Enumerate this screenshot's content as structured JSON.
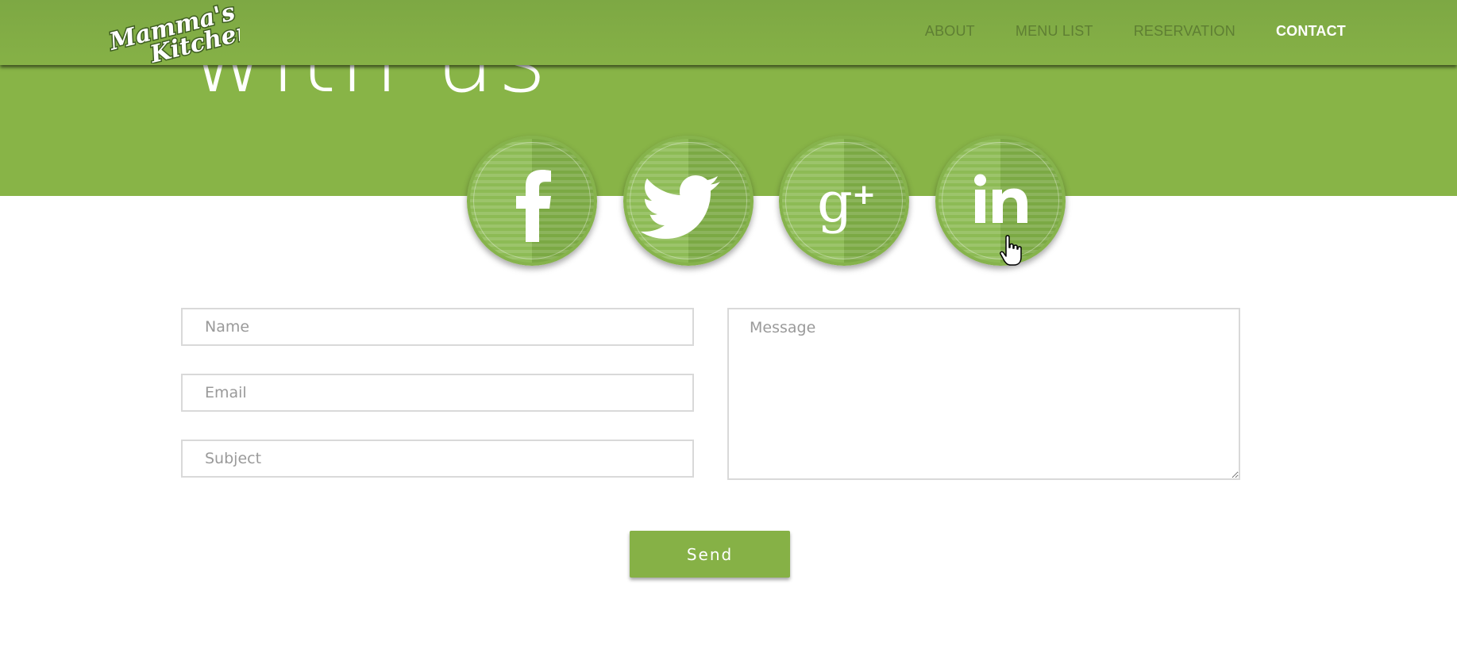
{
  "brand": {
    "logo_text_line1": "Mamma's",
    "logo_text_line2": "Kitchen"
  },
  "nav": {
    "items": [
      {
        "label": "ABOUT",
        "active": false
      },
      {
        "label": "MENU LIST",
        "active": false
      },
      {
        "label": "RESERVATION",
        "active": false
      },
      {
        "label": "CONTACT",
        "active": true
      }
    ]
  },
  "hero": {
    "title": "with us"
  },
  "social": {
    "icons": [
      "facebook-icon",
      "twitter-icon",
      "google-plus-icon",
      "linkedin-icon"
    ]
  },
  "form": {
    "name_placeholder": "Name",
    "email_placeholder": "Email",
    "subject_placeholder": "Subject",
    "message_placeholder": "Message",
    "send_label": "Send"
  },
  "colors": {
    "brand_green": "#86b146",
    "nav_text": "#5e7e33",
    "nav_active": "#ffffff"
  }
}
